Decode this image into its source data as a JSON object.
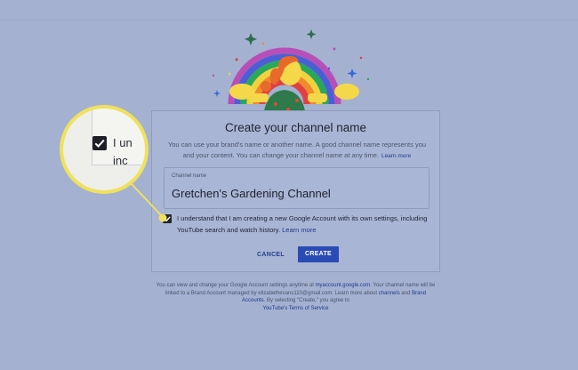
{
  "dialog": {
    "title": "Create your channel name",
    "description": "You can use your brand's name or another name. A good channel name represents you and your content. You can change your channel name at any time.",
    "description_link": "Learn more",
    "field_label": "Channel name",
    "field_value": "Gretchen's Gardening Channel",
    "consent_text": "I understand that I am creating a new Google Account with its own settings, including YouTube search and watch history.",
    "consent_link": "Learn more",
    "consent_checked": true,
    "cancel_label": "CANCEL",
    "create_label": "CREATE"
  },
  "footer": {
    "text1": "You can view and change your Google Account settings anytime at",
    "link1": "myaccount.google.com",
    "text2": ". Your channel name will be linked to a Brand Account managed by elizabethevans110@gmail.com. Learn more about",
    "link2": "channels",
    "text3": "and",
    "link3": "Brand Accounts",
    "text4": ". By selecting \"Create,\" you agree to",
    "link4": "YouTube's Terms of Service"
  },
  "magnifier": {
    "line1": "I un",
    "line2": "inc"
  },
  "colors": {
    "background": "#a4b1d1",
    "primary_button": "#2a4bb5",
    "link": "#1f3a8c",
    "callout": "#f0e15c"
  },
  "icons": [
    "rainbow-illustration",
    "checkmark-icon",
    "sparkle-icon"
  ]
}
